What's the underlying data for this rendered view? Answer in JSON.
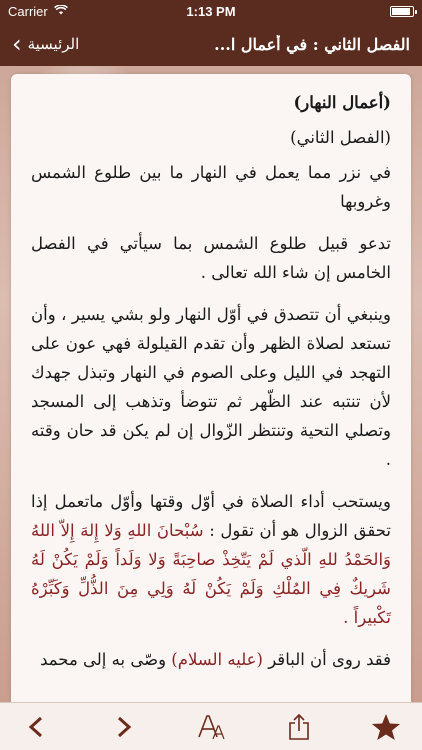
{
  "status": {
    "carrier": "Carrier",
    "time": "1:13 PM",
    "battery_level": 0.9
  },
  "navbar": {
    "back_label": "الرئيسية",
    "title": "الفصل الثاني : في أعمال ا..."
  },
  "content": {
    "heading": "(أعمال النهار)",
    "subheading": "(الفصل الثاني)",
    "p1": "في نزر مما يعمل في النهار ما بين طلوع الشمس وغروبها",
    "p2": "تدعو قبيل طلوع الشمس بما سيأتي في الفصل الخامس إن شاء الله تعالى .",
    "p3": "وينبغي أن تتصدق في أوّل النهار ولو بشي يسير ، وأن تستعد لصلاة الظهر وأن تقدم القيلولة فهي عون على التهجد في الليل وعلى الصوم في النهار وتبذل جهدك لأن تنتبه عند الظّهر ثم تتوضأ وتذهب إلى المسجد وتصلي التحية وتنتظر الزّوال إن لم يكن قد حان وقته .",
    "p4_text": "ويستحب أداء الصلاة في أوّل وقتها وأوّل ماتعمل إذا تحقق الزوال هو أن تقول : ",
    "p4_quote": "سُبْحانَ اللهِ وَلا إِلهَ إِلاّ اللهُ وَالحَمْدُ للهِ الّذي لَمْ يَتّخِذْ صاحِبَةً وَلا وَلَداً وَلَمْ يَكُنْ لَهُ شَريكٌ فِي المُلْكِ وَلَمْ يَكُنْ لَهُ وَلِي مِنَ الذُّلِّ وَكَبِّرْهُ تَكْبيراً .",
    "p5_text": "فقد روى أن الباقر ",
    "p5_quote": "(عليه السلام)",
    "p5_text2": " وصّى به إلى محمد"
  },
  "toolbar": {
    "prev_icon": "chevron-left-icon",
    "next_icon": "chevron-right-icon",
    "font_icon": "font-size-icon",
    "share_icon": "share-icon",
    "favorite_icon": "star-icon"
  },
  "colors": {
    "accent": "#5a2b1f",
    "quote": "#8a2424",
    "toolbar_icon": "#6a2a1c"
  }
}
